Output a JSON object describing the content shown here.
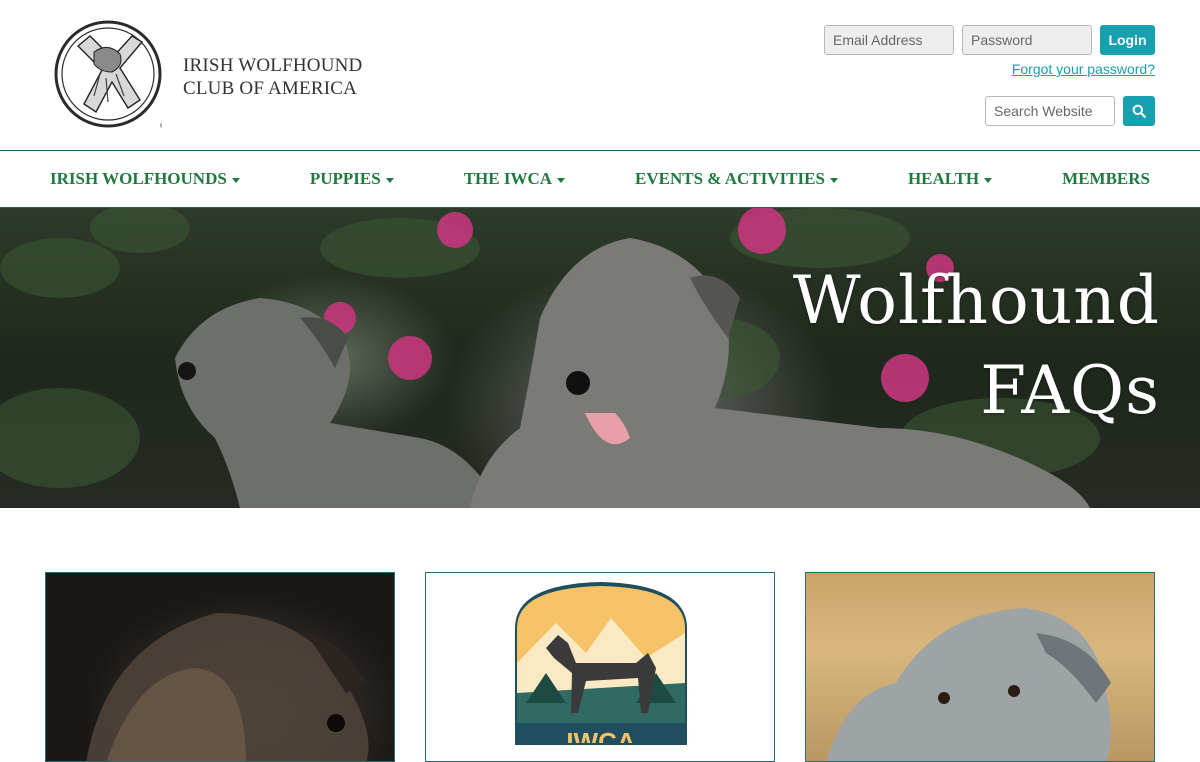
{
  "brand": {
    "line1": "IRISH WOLFHOUND",
    "line2": "CLUB OF AMERICA"
  },
  "login": {
    "email_placeholder": "Email Address",
    "password_placeholder": "Password",
    "button_label": "Login",
    "forgot_label": "Forgot your password?"
  },
  "search": {
    "placeholder": "Search Website",
    "icon": "search-icon"
  },
  "nav": {
    "items": [
      {
        "label": "IRISH WOLFHOUNDS",
        "dropdown": true
      },
      {
        "label": "PUPPIES",
        "dropdown": true
      },
      {
        "label": "THE IWCA",
        "dropdown": true
      },
      {
        "label": "EVENTS & ACTIVITIES",
        "dropdown": true
      },
      {
        "label": "HEALTH",
        "dropdown": true
      },
      {
        "label": "MEMBERS",
        "dropdown": false
      }
    ]
  },
  "hero": {
    "line1": "Wolfhound",
    "line2": "FAQs"
  },
  "cards": {
    "badge_text": "IWCA"
  },
  "colors": {
    "accent": "#16a0b0",
    "nav_green": "#1f7a3f",
    "border_green": "#1d6b3e"
  }
}
